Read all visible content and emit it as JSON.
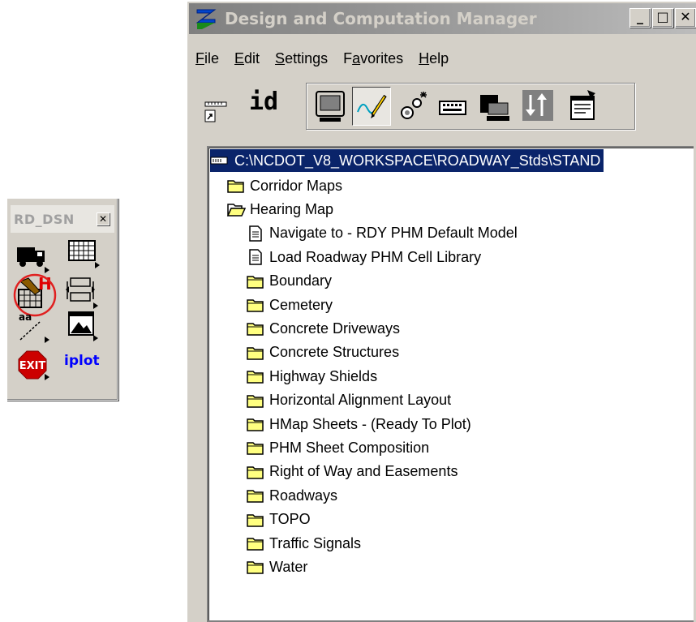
{
  "palette": {
    "title": "RD_DSN",
    "close": "✕",
    "iplot_label": "iplot",
    "exit_label": "EXIT",
    "icons": [
      "truck-icon",
      "grid-icon",
      "hearing-map-icon",
      "spacing-icon",
      "text-line-icon",
      "image-icon",
      "exit-icon",
      "iplot-icon"
    ]
  },
  "window": {
    "title": "Design and Computation Manager",
    "buttons": {
      "minimize": "_",
      "maximize": "□",
      "close": "✕"
    },
    "menu": [
      {
        "label": "File",
        "key": "F",
        "rest": "ile"
      },
      {
        "label": "Edit",
        "key": "E",
        "rest": "dit"
      },
      {
        "label": "Settings",
        "key": "S",
        "rest": "ettings"
      },
      {
        "label": "Favorites",
        "pre": "F",
        "key": "a",
        "rest": "vorites"
      },
      {
        "label": "Help",
        "key": "H",
        "rest": "elp"
      }
    ],
    "toolbar": {
      "id_label": "id",
      "buttons": [
        "shortcut-icon",
        "id-icon",
        "monitor-icon",
        "draw-icon",
        "key-in-icon",
        "keyboard-icon",
        "view-icon",
        "sort-icon",
        "properties-icon"
      ]
    },
    "tree": {
      "root": "C:\\NCDOT_V8_WORKSPACE\\ROADWAY_Stds\\STAND",
      "items": [
        {
          "label": "Corridor Maps",
          "type": "folder",
          "indent": 1
        },
        {
          "label": "Hearing Map",
          "type": "folder-open",
          "indent": 1
        },
        {
          "label": "Navigate to - RDY PHM Default Model",
          "type": "doc",
          "indent": 2
        },
        {
          "label": "Load Roadway PHM Cell Library",
          "type": "doc",
          "indent": 2
        },
        {
          "label": "Boundary",
          "type": "folder",
          "indent": 2
        },
        {
          "label": "Cemetery",
          "type": "folder",
          "indent": 2
        },
        {
          "label": "Concrete Driveways",
          "type": "folder",
          "indent": 2
        },
        {
          "label": "Concrete Structures",
          "type": "folder",
          "indent": 2
        },
        {
          "label": "Highway Shields",
          "type": "folder",
          "indent": 2
        },
        {
          "label": "Horizontal Alignment Layout",
          "type": "folder",
          "indent": 2
        },
        {
          "label": "HMap Sheets - (Ready To Plot)",
          "type": "folder",
          "indent": 2
        },
        {
          "label": "PHM Sheet Composition",
          "type": "folder",
          "indent": 2
        },
        {
          "label": "Right of Way and Easements",
          "type": "folder",
          "indent": 2
        },
        {
          "label": "Roadways",
          "type": "folder",
          "indent": 2
        },
        {
          "label": "TOPO",
          "type": "folder",
          "indent": 2
        },
        {
          "label": "Traffic Signals",
          "type": "folder",
          "indent": 2
        },
        {
          "label": "Water",
          "type": "folder",
          "indent": 2
        }
      ]
    }
  },
  "colors": {
    "window_bg": "#d4d0c8",
    "selection_bg": "#0a246a",
    "folder_yellow": "#ffff80",
    "exit_red": "#cc0000",
    "iplot_blue": "#0000ff",
    "highlight_circle": "#e02020"
  }
}
